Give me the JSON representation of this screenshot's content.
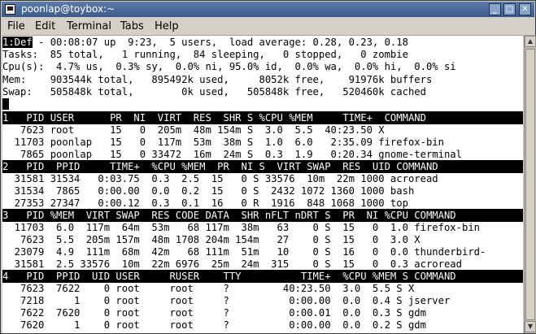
{
  "window": {
    "title": "poonlap@toybox:~",
    "minimize_label": "_",
    "maximize_label": "□",
    "close_label": "✕"
  },
  "menu": {
    "file": "File",
    "edit": "Edit",
    "terminal": "Terminal",
    "tabs": "Tabs",
    "help": "Help"
  },
  "summary": {
    "def_label": "1:Def",
    "uptime": " - 00:08:07 up  9:23,  5 users,  load average: 0.28, 0.23, 0.18",
    "tasks": "Tasks:  85 total,   1 running,  84 sleeping,   0 stopped,   0 zombie",
    "cpu": "Cpu(s):  4.7% us,  0.3% sy,  0.0% ni, 95.0% id,  0.0% wa,  0.0% hi,  0.0% si",
    "mem": "Mem:    903544k total,   895492k used,     8052k free,    91976k buffers",
    "swap": "Swap:   505848k total,        0k used,   505848k free,   520460k cached"
  },
  "windows": [
    {
      "header": "1   PID USER      PR  NI  VIRT  RES  SHR S %CPU %MEM     TIME+  COMMAND",
      "rows": [
        "   7623 root      15   0  205m  48m 154m S  3.0  5.5  40:23.50 X",
        "  11703 poonlap   15   0  117m  53m  38m S  1.0  6.0   2:35.09 firefox-bin",
        "   7865 poonlap   15   0 33472  16m  24m S  0.3  1.9   0:20.34 gnome-terminal"
      ]
    },
    {
      "header": "2   PID  PPID     TIME+  %CPU %MEM  PR  NI S  VIRT SWAP  RES  UID COMMAND",
      "rows": [
        "  31581 31534   0:03.75  0.3  2.5  15   0 S 33576  10m  22m 1000 acroread",
        "  31534  7865   0:00.00  0.0  0.2  15   0 S  2432 1072 1360 1000 bash",
        "  27353 27347   0:00.12  0.3  0.1  16   0 R  1916  848 1068 1000 top"
      ]
    },
    {
      "header": "3   PID %MEM  VIRT SWAP  RES CODE DATA  SHR nFLT nDRT S  PR  NI %CPU COMMAND",
      "rows": [
        "  11703  6.0  117m  64m  53m   68 117m  38m   63    0 S  15   0  1.0 firefox-bin",
        "   7623  5.5  205m 157m  48m 1708 204m 154m   27    0 S  15   0  3.0 X",
        "  23079  4.9  111m  68m  42m   68 111m  51m   10    0 S  16   0  0.0 thunderbird-",
        "  31581  2.5 33576  10m  22m 6976  25m  24m  315    0 S  15   0  0.3 acroread"
      ]
    },
    {
      "header": "4   PID  PPID  UID USER     RUSER    TTY          TIME+  %CPU %MEM S COMMAND",
      "rows": [
        "   7623  7622    0 root     root     ?         40:23.50  3.0  5.5 S X",
        "   7218     1    0 root     root     ?          0:00.00  0.0  0.4 S jserver",
        "   7622  7620    0 root     root     ?          0:00.01  0.0  0.3 S gdm",
        "   7620     1    0 root     root     ?          0:00.00  0.0  0.2 S gdm"
      ]
    }
  ]
}
